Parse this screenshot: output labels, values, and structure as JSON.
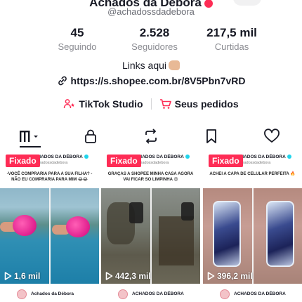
{
  "profile": {
    "handle": "@achadossdadebora",
    "stats": [
      {
        "value": "45",
        "label": "Seguindo"
      },
      {
        "value": "2.528",
        "label": "Seguidores"
      },
      {
        "value": "217,5 mil",
        "label": "Curtidas"
      }
    ],
    "bio": "Links aqui",
    "link": "https://s.shopee.com.br/8V5Pbn7vRD"
  },
  "actions": {
    "studio_label": "TikTok Studio",
    "orders_label": "Seus pedidos"
  },
  "tabs": [
    {
      "icon": "grid-icon",
      "active": true
    },
    {
      "icon": "lock-icon",
      "active": false
    },
    {
      "icon": "repost-icon",
      "active": false
    },
    {
      "icon": "bookmark-icon",
      "active": false
    },
    {
      "icon": "heart-icon",
      "active": false
    }
  ],
  "videos": [
    {
      "pinned_label": "Fixado",
      "creator": "ACHADOS DA DÉBORA",
      "creator_handle": "@achadossdadebora",
      "caption": "-VOCÊ COMPRARIA PARA A SUA FILHA? - NÃO EU COMPRARIA PARA MIM 😂😂",
      "views": "1,6 mil"
    },
    {
      "pinned_label": "Fixado",
      "creator": "ACHADOS DA DÉBORA",
      "creator_handle": "@achadossdadebora",
      "caption": "GRAÇAS A SHOPEE MINHA CASA AGORA VAI FICAR SO LIMPINHA 😍",
      "views": "442,3 mil"
    },
    {
      "pinned_label": "Fixado",
      "creator": "ACHADOS DA DÉBORA",
      "creator_handle": "@achadossdadebora",
      "caption": "ACHEI A CAPA DE CELULAR PERFEITA 🔥",
      "views": "396,2 mil"
    }
  ],
  "next_row": [
    {
      "creator": "Achados da Débora"
    },
    {
      "creator": "ACHADOS DA DÉBORA"
    },
    {
      "creator": "ACHADOS DA DÉBORA"
    }
  ],
  "colors": {
    "accent": "#fe2c55",
    "text": "#161823",
    "muted": "#8a8b91"
  }
}
